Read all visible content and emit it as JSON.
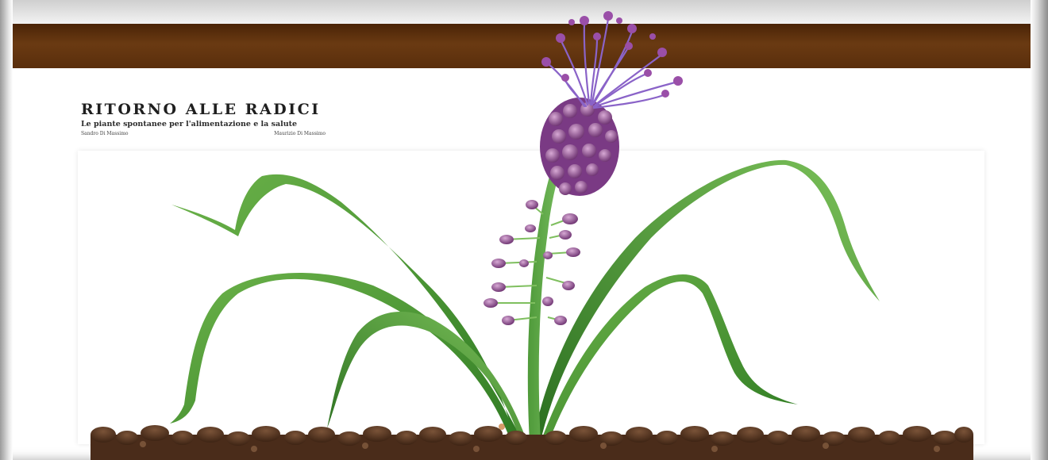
{
  "header": {
    "title": "RITORNO ALLE RADICI",
    "subtitle": "Le piante spontanee per l'alimentazione e la salute",
    "author_left": "Sandro Di Massimo",
    "author_right": "Maurizio Di Massimo"
  },
  "colors": {
    "band": "#5a2e0c",
    "leaf": "#3f8f2c",
    "flower": "#7b3f8a",
    "soil": "#5a3a24"
  },
  "image": {
    "subject": "plant-with-purple-tassel-flower",
    "icon": "plant-illustration"
  }
}
